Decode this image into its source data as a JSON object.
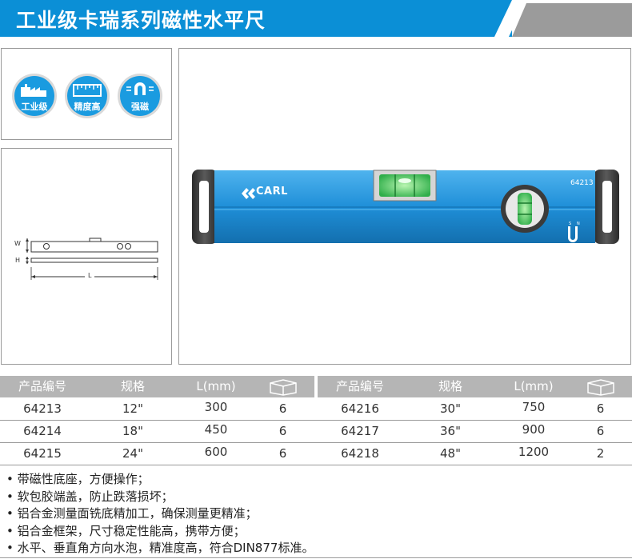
{
  "header": {
    "title": "工业级卡瑞系列磁性水平尺"
  },
  "badges": [
    {
      "label": "工业级",
      "icon": "factory-icon"
    },
    {
      "label": "精度高",
      "icon": "ruler-icon"
    },
    {
      "label": "强磁",
      "icon": "magnet-icon"
    }
  ],
  "product": {
    "brand": "CARL",
    "model": "64213",
    "magnet_text": {
      "s": "S",
      "n": "N"
    }
  },
  "dimension_drawing": {
    "w": "W",
    "h": "H",
    "l": "L"
  },
  "table": {
    "headers": [
      "产品编号",
      "规格",
      "L(mm)",
      "",
      "产品编号",
      "规格",
      "L(mm)",
      ""
    ],
    "box_icon": "package-box-icon",
    "rows": [
      [
        "64213",
        "12\"",
        "300",
        "6",
        "64216",
        "30\"",
        "750",
        "6"
      ],
      [
        "64214",
        "18\"",
        "450",
        "6",
        "64217",
        "36\"",
        "900",
        "6"
      ],
      [
        "64215",
        "24\"",
        "600",
        "6",
        "64218",
        "48\"",
        "1200",
        "2"
      ]
    ]
  },
  "features": [
    "• 带磁性底座，方便操作；",
    "• 软包胶端盖，防止跌落损坏；",
    "• 铝合金测量面铣底精加工，确保测量更精准；",
    "• 铝合金框架，尺寸稳定性能高，携带方便；",
    "• 水平、垂直角方向水泡，精准度高，符合DIN877标准。"
  ],
  "colors": {
    "header_blue": "#0b8fd6",
    "header_gray": "#9b9b9b",
    "table_header_gray": "#b5b5b5",
    "badge_blue": "#1a9be0",
    "level_blue": "#1f8fd8"
  }
}
